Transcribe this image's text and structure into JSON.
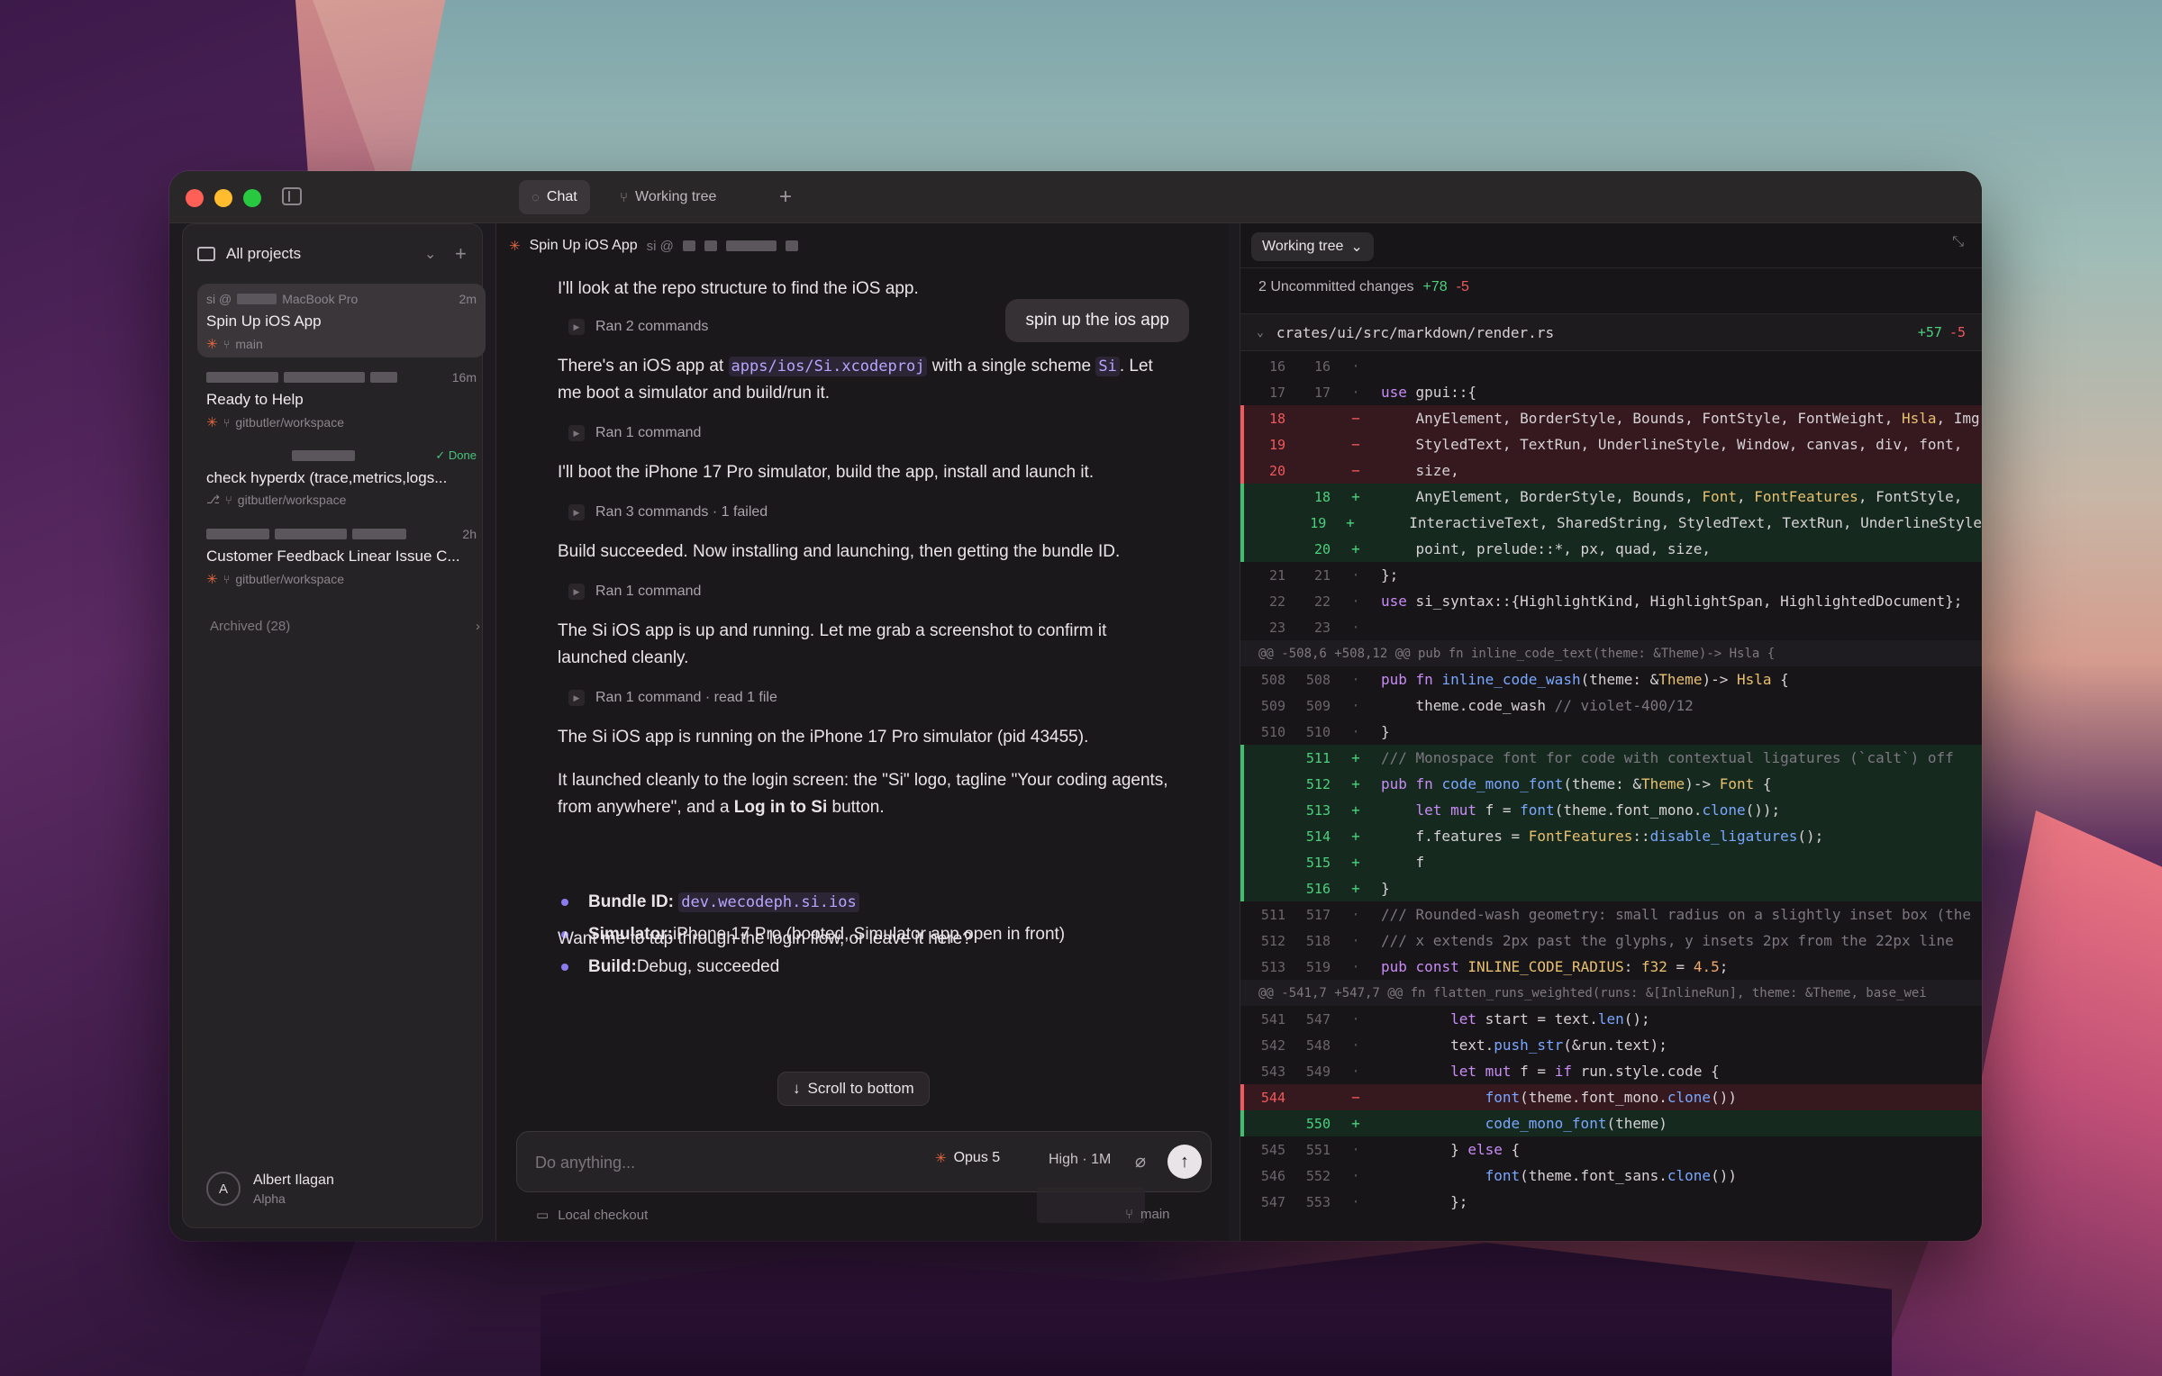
{
  "titlebar": {
    "tabs": [
      {
        "label": "Chat",
        "icon": "chat-bubble-icon"
      },
      {
        "label": "Working tree",
        "icon": "branch-icon"
      }
    ],
    "add_tab": "+"
  },
  "sidebar": {
    "header": "All projects",
    "projects": [
      {
        "device": "si @",
        "host": "MacBook Pro",
        "time": "2m",
        "title": "Spin Up iOS App",
        "branch": "main",
        "status": ""
      },
      {
        "device": "",
        "host": "",
        "time": "16m",
        "title": "Ready to Help",
        "branch": "gitbutler/workspace",
        "status": ""
      },
      {
        "device": "",
        "host": "",
        "time": "",
        "title": "check hyperdx (trace,metrics,logs...",
        "branch": "gitbutler/workspace",
        "status": "✓ Done"
      },
      {
        "device": "",
        "host": "",
        "time": "2h",
        "title": "Customer Feedback Linear Issue C...",
        "branch": "gitbutler/workspace",
        "status": ""
      }
    ],
    "archived": "Archived (28)",
    "user": {
      "initial": "A",
      "name": "Albert Ilagan",
      "role": "Alpha"
    }
  },
  "chat": {
    "title": "Spin Up iOS App",
    "meta": "si @",
    "user_message": "spin up the ios app",
    "messages": {
      "m1": "I'll look at the repo structure to find the iOS app.",
      "ran1": "Ran 2 commands",
      "m2_a": "There's an iOS app at ",
      "m2_code1": "apps/ios/Si.xcodeproj",
      "m2_b": " with a single scheme ",
      "m2_code2": "Si",
      "m2_c": ". Let me boot a simulator and build/run it.",
      "ran2": "Ran 1 command",
      "m3": "I'll boot the iPhone 17 Pro simulator, build the app, install and launch it.",
      "ran3": "Ran 3 commands · 1 failed",
      "m4": "Build succeeded. Now installing and launching, then getting the bundle ID.",
      "ran4": "Ran 1 command",
      "m5": "The Si iOS app is up and running. Let me grab a screenshot to confirm it launched cleanly.",
      "ran5": "Ran 1 command · read 1 file",
      "m6": "The Si iOS app is running on the iPhone 17 Pro simulator (pid 43455).",
      "m7_a": "It launched cleanly to the login screen: the \"Si\" logo, tagline \"Your coding agents, from anywhere\", and a ",
      "m7_bold": "Log in to Si",
      "m7_b": " button.",
      "m8": "Want me to tap through the login flow, or leave it here?"
    },
    "bullets": [
      {
        "label": "Bundle ID:",
        "value": "dev.wecodeph.si.ios",
        "code": true
      },
      {
        "label": "Simulator:",
        "value": " iPhone 17 Pro (booted, Simulator app open in front)",
        "code": false
      },
      {
        "label": "Build:",
        "value": " Debug, succeeded",
        "code": false
      }
    ],
    "scroll_to_bottom": "Scroll to bottom",
    "composer": {
      "placeholder": "Do anything...",
      "model": "Opus 5",
      "effort": "High · 1M"
    },
    "footer": {
      "checkout": "Local checkout",
      "branch": "main"
    }
  },
  "diff": {
    "dropdown": "Working tree",
    "summary": "2 Uncommitted changes",
    "summary_add": "+78",
    "summary_del": "-5",
    "file": "crates/ui/src/markdown/render.rs",
    "file_add": "+57",
    "file_del": "-5",
    "lines": [
      {
        "t": "ctx",
        "a": "16",
        "b": "16",
        "code": ""
      },
      {
        "t": "ctx",
        "a": "17",
        "b": "17",
        "code": "use gpui::{"
      },
      {
        "t": "del",
        "a": "18",
        "b": "",
        "code": "    AnyElement, BorderStyle, Bounds, FontStyle, FontWeight, Hsla, Img"
      },
      {
        "t": "del",
        "a": "19",
        "b": "",
        "code": "    StyledText, TextRun, UnderlineStyle, Window, canvas, div, font,"
      },
      {
        "t": "del",
        "a": "20",
        "b": "",
        "code": "    size,"
      },
      {
        "t": "add",
        "a": "",
        "b": "18",
        "code": "    AnyElement, BorderStyle, Bounds, Font, FontFeatures, FontStyle,"
      },
      {
        "t": "add",
        "a": "",
        "b": "19",
        "code": "    InteractiveText, SharedString, StyledText, TextRun, UnderlineStyle"
      },
      {
        "t": "add",
        "a": "",
        "b": "20",
        "code": "    point, prelude::*, px, quad, size,"
      },
      {
        "t": "ctx",
        "a": "21",
        "b": "21",
        "code": "};"
      },
      {
        "t": "ctx",
        "a": "22",
        "b": "22",
        "code": "use si_syntax::{HighlightKind, HighlightSpan, HighlightedDocument};"
      },
      {
        "t": "ctx",
        "a": "23",
        "b": "23",
        "code": ""
      },
      {
        "t": "hunk",
        "code": "@@ -508,6 +508,12 @@ pub fn inline_code_text(theme: &Theme)-> Hsla {"
      },
      {
        "t": "ctx",
        "a": "508",
        "b": "508",
        "code": "pub fn inline_code_wash(theme: &Theme)-> Hsla {"
      },
      {
        "t": "ctx",
        "a": "509",
        "b": "509",
        "code": "    theme.code_wash // violet-400/12"
      },
      {
        "t": "ctx",
        "a": "510",
        "b": "510",
        "code": "}"
      },
      {
        "t": "add",
        "a": "",
        "b": "511",
        "code": "/// Monospace font for code with contextual ligatures (`calt`) off"
      },
      {
        "t": "add",
        "a": "",
        "b": "512",
        "code": "pub fn code_mono_font(theme: &Theme)-> Font {"
      },
      {
        "t": "add",
        "a": "",
        "b": "513",
        "code": "    let mut f = font(theme.font_mono.clone());"
      },
      {
        "t": "add",
        "a": "",
        "b": "514",
        "code": "    f.features = FontFeatures::disable_ligatures();"
      },
      {
        "t": "add",
        "a": "",
        "b": "515",
        "code": "    f"
      },
      {
        "t": "add",
        "a": "",
        "b": "516",
        "code": "}"
      },
      {
        "t": "ctx",
        "a": "511",
        "b": "517",
        "code": "/// Rounded-wash geometry: small radius on a slightly inset box (the"
      },
      {
        "t": "ctx",
        "a": "512",
        "b": "518",
        "code": "/// x extends 2px past the glyphs, y insets 2px from the 22px line"
      },
      {
        "t": "ctx",
        "a": "513",
        "b": "519",
        "code": "pub const INLINE_CODE_RADIUS: f32 = 4.5;"
      },
      {
        "t": "hunk",
        "code": "@@ -541,7 +547,7 @@ fn flatten_runs_weighted(runs: &[InlineRun], theme: &Theme, base_wei"
      },
      {
        "t": "ctx",
        "a": "541",
        "b": "547",
        "code": "        let start = text.len();"
      },
      {
        "t": "ctx",
        "a": "542",
        "b": "548",
        "code": "        text.push_str(&run.text);"
      },
      {
        "t": "ctx",
        "a": "543",
        "b": "549",
        "code": "        let mut f = if run.style.code {"
      },
      {
        "t": "del",
        "a": "544",
        "b": "",
        "code": "            font(theme.font_mono.clone())"
      },
      {
        "t": "add",
        "a": "",
        "b": "550",
        "code": "            code_mono_font(theme)"
      },
      {
        "t": "ctx",
        "a": "545",
        "b": "551",
        "code": "        } else {"
      },
      {
        "t": "ctx",
        "a": "546",
        "b": "552",
        "code": "            font(theme.font_sans.clone())"
      },
      {
        "t": "ctx",
        "a": "547",
        "b": "553",
        "code": "        };"
      }
    ]
  }
}
